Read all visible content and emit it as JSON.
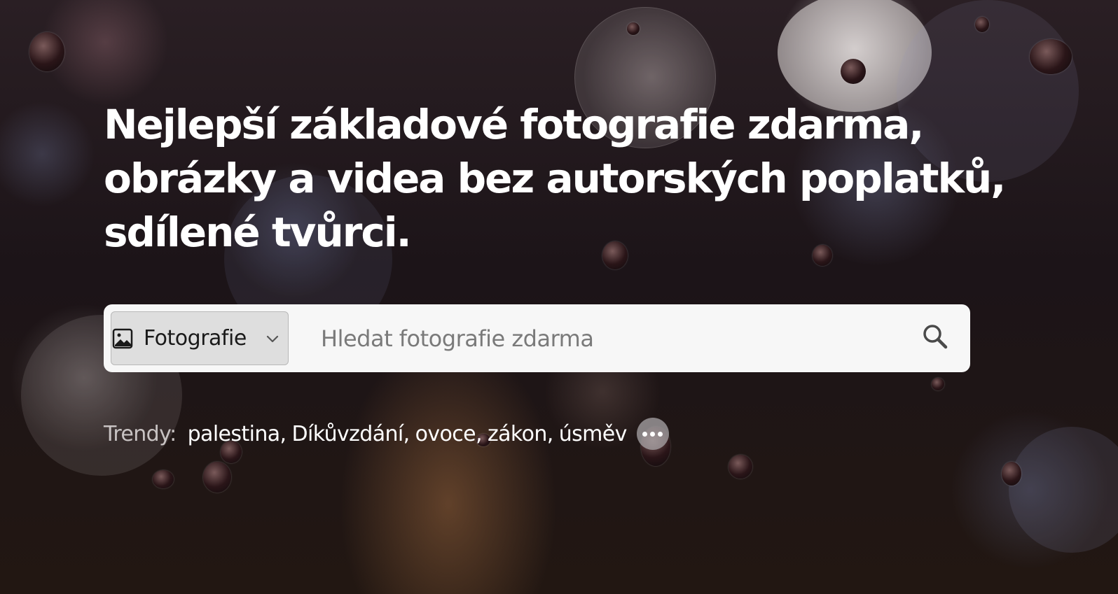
{
  "hero": {
    "headline": "Nejlepší základové fotografie zdarma, obrázky a videa bez autorských poplatků, sdílené tvůrci."
  },
  "search": {
    "type_selector": {
      "selected": "Fotografie",
      "icon": "image-icon"
    },
    "placeholder": "Hledat fotografie zdarma",
    "button_icon": "search-icon"
  },
  "trending": {
    "label": "Trendy:",
    "items": [
      "palestina",
      "Díkůvzdání",
      "ovoce",
      "zákon",
      "úsměv"
    ],
    "more_icon": "more-dots-icon"
  },
  "colors": {
    "search_background": "#f7f7f7",
    "selector_background": "#dedede",
    "text_white": "#ffffff"
  }
}
